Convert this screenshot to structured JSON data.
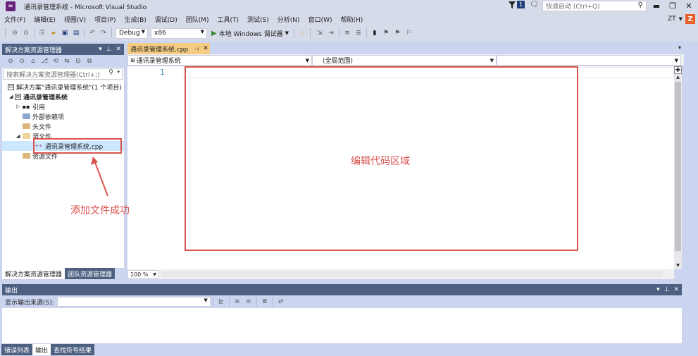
{
  "window": {
    "title": "通讯录管理系统 - Microsoft Visual Studio",
    "notification_count": "1",
    "quick_launch_placeholder": "快速启动 (Ctrl+Q)",
    "user_initials": "ZT",
    "user_avatar_letter": "Z"
  },
  "menu": {
    "items": [
      "文件(F)",
      "编辑(E)",
      "视图(V)",
      "项目(P)",
      "生成(B)",
      "调试(D)",
      "团队(M)",
      "工具(T)",
      "测试(S)",
      "分析(N)",
      "窗口(W)",
      "帮助(H)"
    ]
  },
  "toolbar": {
    "config": "Debug",
    "platform": "x86",
    "run_label": "本地 Windows 调试器"
  },
  "solution_explorer": {
    "title": "解决方案资源管理器",
    "search_placeholder": "搜索解决方案资源管理器(Ctrl+;)",
    "tree": [
      {
        "label": "解决方案\"通讯录管理系统\"(1 个项目)",
        "bold": false
      },
      {
        "label": "通讯录管理系统",
        "bold": true
      },
      {
        "label": "引用",
        "bold": false
      },
      {
        "label": "外部依赖项",
        "bold": false
      },
      {
        "label": "头文件",
        "bold": false
      },
      {
        "label": "源文件",
        "bold": false
      },
      {
        "label": "通讯录管理系统.cpp",
        "bold": false
      },
      {
        "label": "资源文件",
        "bold": false
      }
    ],
    "tabs": [
      "解决方案资源管理器",
      "团队资源管理器"
    ]
  },
  "editor": {
    "tab_label": "通讯录管理系统.cpp",
    "nav_project": "通讯录管理系统",
    "nav_scope": "(全局范围)",
    "line_number": "1",
    "zoom": "100 %"
  },
  "annotations": {
    "editor_area_label": "编辑代码区域",
    "file_added_label": "添加文件成功",
    "color": "#d9534f"
  },
  "output": {
    "title": "输出",
    "source_label": "显示输出来源(S):"
  },
  "bottom_tabs": [
    "错误列表",
    "输出",
    "查找符号结果"
  ]
}
